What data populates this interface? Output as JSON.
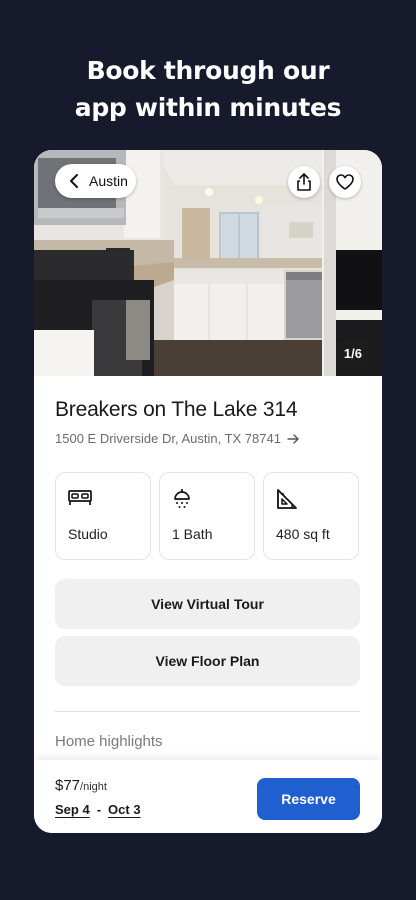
{
  "headline": {
    "line1": "Book through our",
    "line2": "app within minutes"
  },
  "hero": {
    "back_label": "Austin",
    "photo_counter": "1/6",
    "icons": {
      "back": "chevron-left-icon",
      "share": "share-icon",
      "favorite": "heart-icon"
    }
  },
  "listing": {
    "title": "Breakers on The Lake 314",
    "address": "1500 E Driverside Dr, Austin, TX 78741"
  },
  "features": [
    {
      "icon": "bed-icon",
      "label": "Studio"
    },
    {
      "icon": "shower-icon",
      "label": "1 Bath"
    },
    {
      "icon": "ruler-triangle-icon",
      "label": "480 sq ft"
    }
  ],
  "actions": {
    "virtual_tour": "View Virtual Tour",
    "floor_plan": "View Floor Plan"
  },
  "highlights": {
    "title": "Home highlights"
  },
  "booking": {
    "price": "$77",
    "price_unit": "/night",
    "check_in": "Sep 4",
    "separator": "-",
    "check_out": "Oct 3",
    "reserve_label": "Reserve",
    "accent_color": "#1f5fd0"
  },
  "theme": {
    "background": "#171a2c"
  }
}
